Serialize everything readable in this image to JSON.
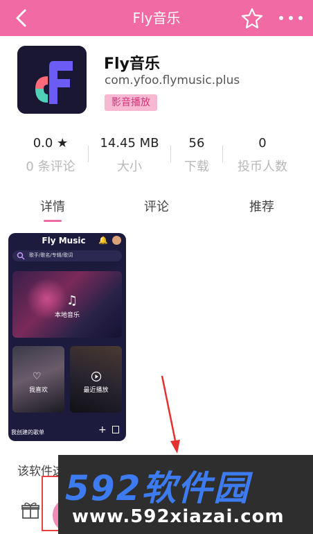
{
  "header": {
    "title": "Fly音乐",
    "accent": "#f26aa3",
    "icons": [
      "back-icon",
      "star-icon",
      "more-icon"
    ]
  },
  "app": {
    "name": "Fly音乐",
    "package": "com.yfoo.flymusic.plus",
    "tag": "影音播放"
  },
  "stats": [
    {
      "value": "0.0",
      "label": "0 条评论"
    },
    {
      "value": "14.45 MB",
      "label": "大小"
    },
    {
      "value": "56",
      "label": "下载"
    },
    {
      "value": "0",
      "label": "投币人数"
    }
  ],
  "tabs": [
    "详情",
    "评论",
    "推荐"
  ],
  "screenshot": {
    "title": "Fly Music",
    "search_placeholder": "歌手/歌名/专辑/歌词",
    "local_music": "本地音乐",
    "favorites": "我喜欢",
    "recent": "最近播放",
    "my_playlists": "我创建的歌单"
  },
  "description": "该软件这",
  "watermark": {
    "brand": "592软件园",
    "url": "www.592xiazai.com"
  }
}
